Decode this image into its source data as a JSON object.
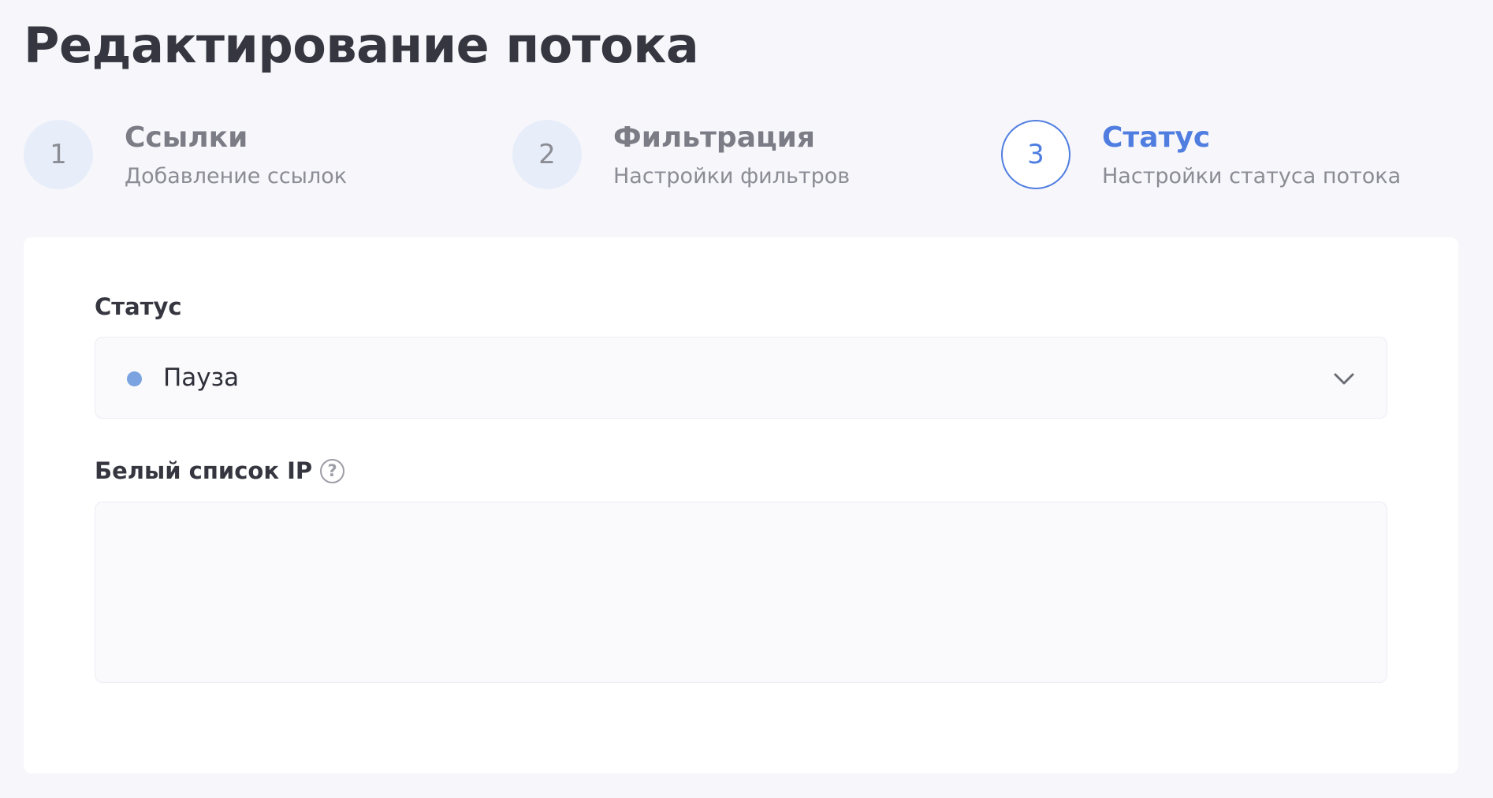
{
  "page": {
    "title": "Редактирование потока"
  },
  "steps": [
    {
      "number": "1",
      "title": "Ссылки",
      "subtitle": "Добавление ссылок",
      "state": "inactive"
    },
    {
      "number": "2",
      "title": "Фильтрация",
      "subtitle": "Настройки фильтров",
      "state": "inactive"
    },
    {
      "number": "3",
      "title": "Статус",
      "subtitle": "Настройки статуса потока",
      "state": "active"
    }
  ],
  "form": {
    "status": {
      "label": "Статус",
      "value": "Пауза",
      "dot_color": "#7aa3e0",
      "icon": "chevron-down-icon"
    },
    "whitelist": {
      "label": "Белый список IP",
      "help_icon": "question-mark-icon",
      "help_glyph": "?",
      "value": "",
      "placeholder": ""
    }
  },
  "colors": {
    "accent": "#4f7de0",
    "background": "#f6f6fb",
    "text": "#35363f",
    "muted": "#8b8c94"
  }
}
